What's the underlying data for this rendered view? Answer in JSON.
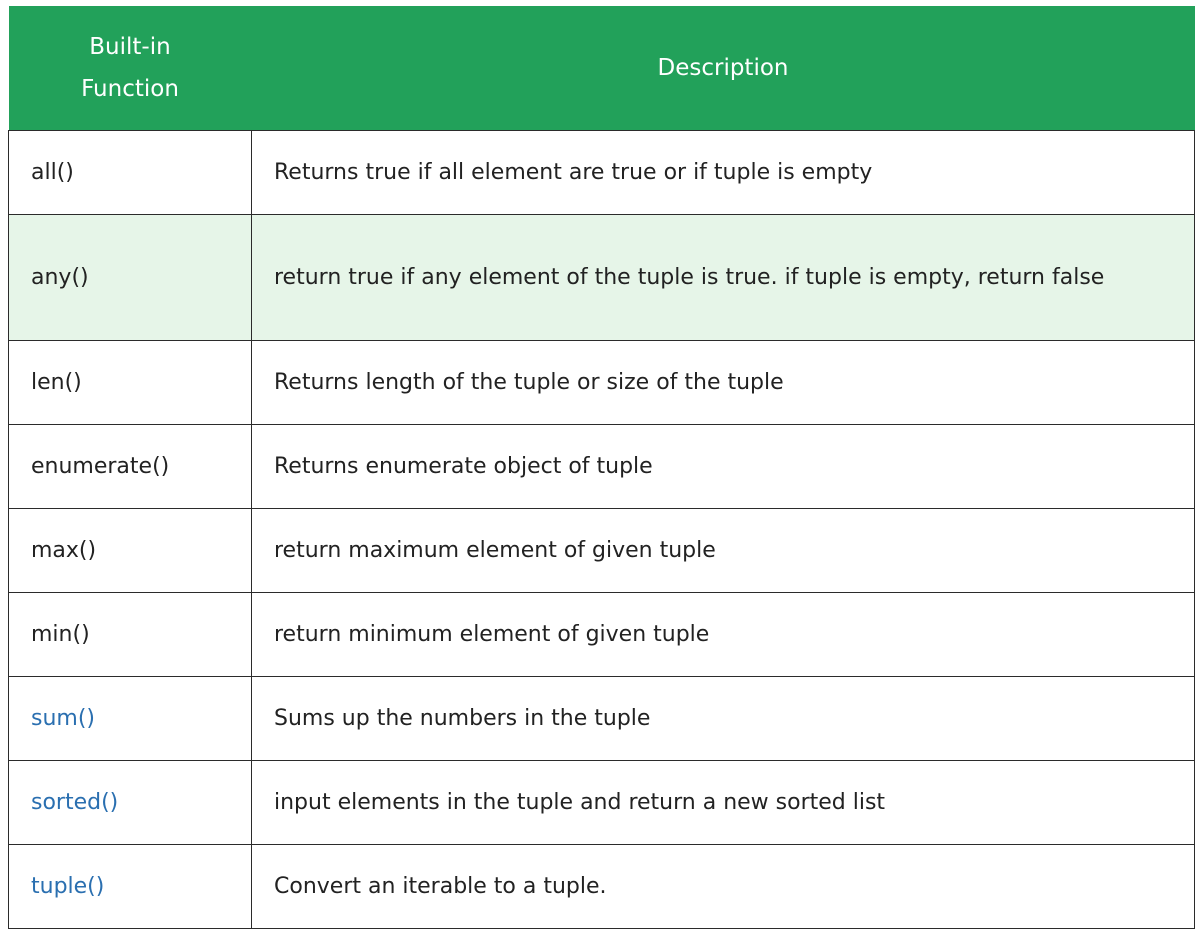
{
  "table": {
    "headers": {
      "function": "Built-in Function",
      "description": "Description"
    },
    "rows": [
      {
        "function": "all()",
        "description": "Returns true if all element are true or if tuple is empty"
      },
      {
        "function": "any()",
        "description": "return true if any element of the tuple is true. if tuple is empty, return false"
      },
      {
        "function": "len()",
        "description": "Returns length of the tuple or size of the tuple"
      },
      {
        "function": "enumerate()",
        "description": "Returns enumerate object of tuple"
      },
      {
        "function": "max()",
        "description": "return maximum element of given tuple"
      },
      {
        "function": "min()",
        "description": "return minimum element of given tuple"
      },
      {
        "function": "sum()",
        "description": "Sums up the numbers in the tuple"
      },
      {
        "function": "sorted()",
        "description": "input elements in the tuple and return a new sorted list"
      },
      {
        "function": "tuple()",
        "description": "Convert an iterable to a tuple."
      }
    ]
  },
  "colors": {
    "header_bg": "#22a15a",
    "highlight_row_bg": "#e6f5e8",
    "link": "#2a6fb0"
  }
}
